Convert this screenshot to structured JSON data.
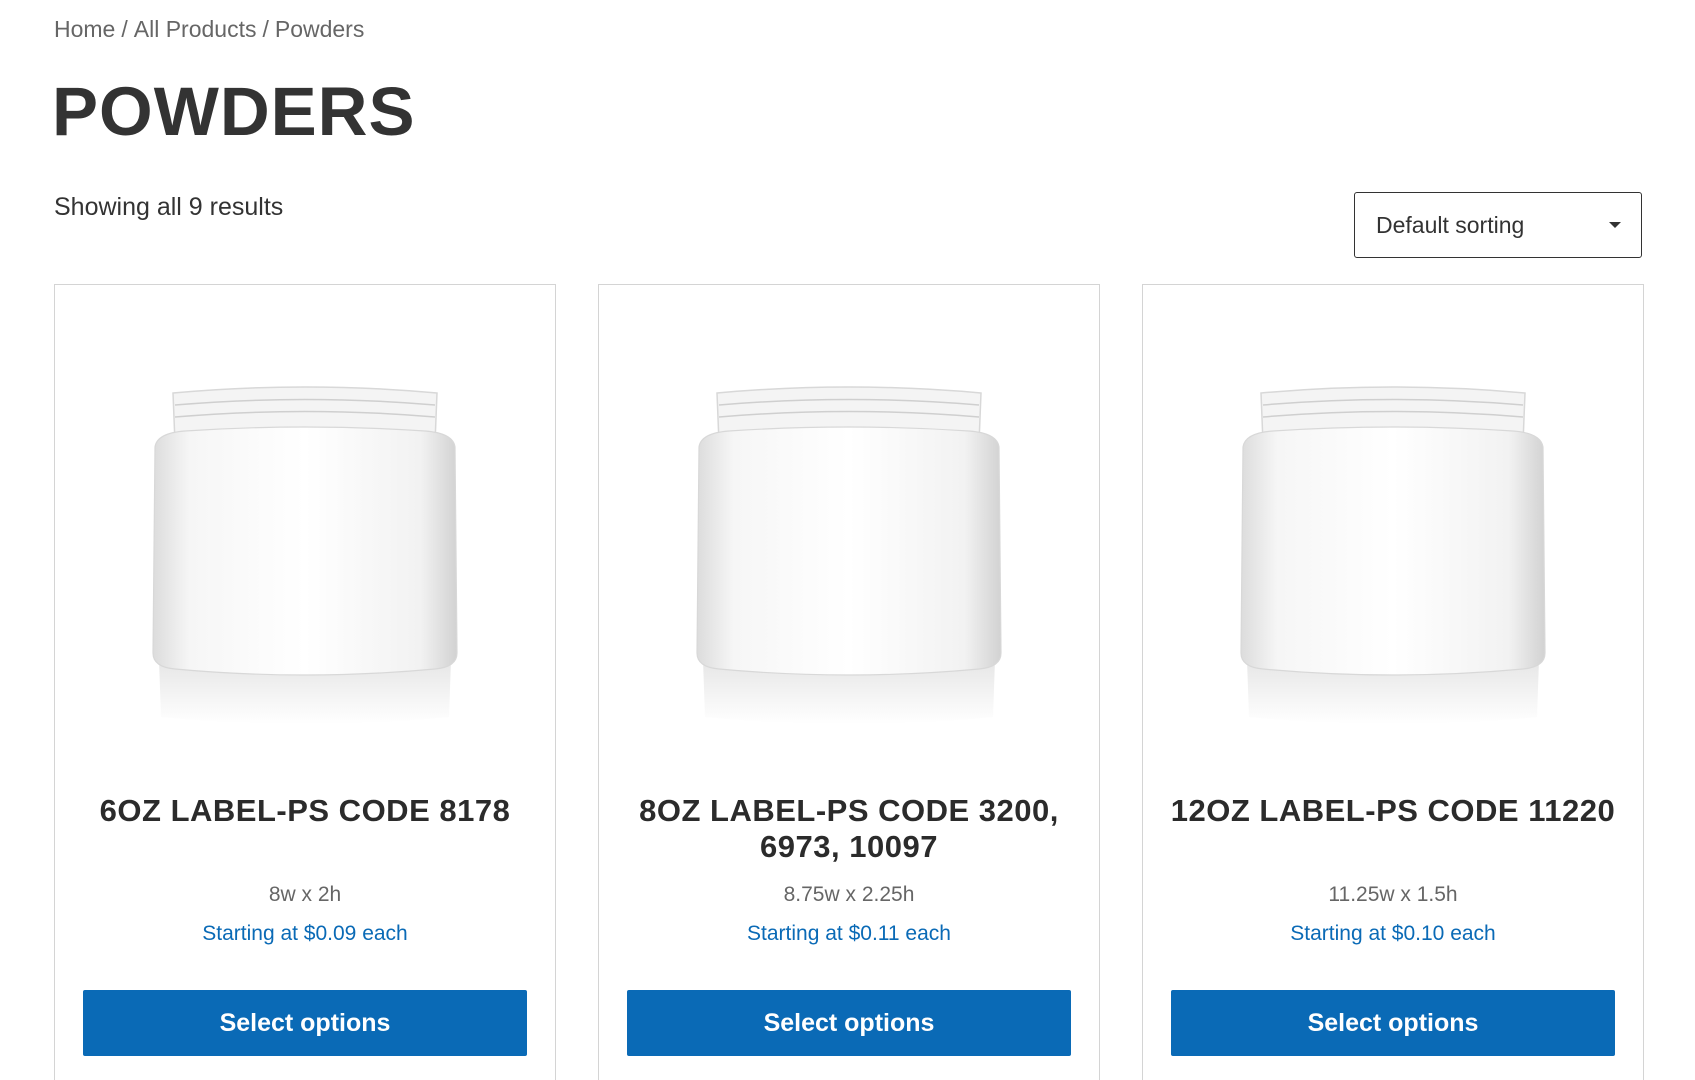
{
  "breadcrumb": {
    "items": [
      "Home",
      "All Products",
      "Powders"
    ],
    "separator": "/"
  },
  "page": {
    "title": "POWDERS",
    "result_count": "Showing all 9 results"
  },
  "sorting": {
    "selected": "Default sorting",
    "icon": "chevron-down-icon"
  },
  "products": [
    {
      "title": "6OZ LABEL-PS CODE 8178",
      "dimensions": "8w x 2h",
      "price": "Starting at $0.09 each",
      "button_label": "Select options",
      "image": "white-jar"
    },
    {
      "title": "8OZ LABEL-PS CODE 3200, 6973, 10097",
      "dimensions": "8.75w x 2.25h",
      "price": "Starting at $0.11 each",
      "button_label": "Select options",
      "image": "white-jar"
    },
    {
      "title": "12OZ LABEL-PS CODE 11220",
      "dimensions": "11.25w x 1.5h",
      "price": "Starting at $0.10 each",
      "button_label": "Select options",
      "image": "white-jar"
    }
  ],
  "colors": {
    "accent": "#0a6ab6",
    "heading": "#333333",
    "muted": "#666666",
    "border": "#d4d4d4"
  }
}
